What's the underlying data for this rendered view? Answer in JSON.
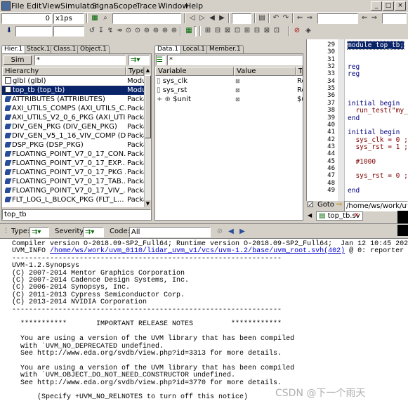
{
  "menu": {
    "items": [
      "File",
      "Edit",
      "View",
      "Simulator",
      "Signal",
      "Scope",
      "Trace",
      "Window",
      "Help"
    ]
  },
  "toolbar": {
    "time_value": "0",
    "time_unit": "x1ps"
  },
  "hierarchy_pane": {
    "tabs": [
      "Hier.1",
      "Stack.1",
      "Class.1",
      "Object.1"
    ],
    "sim_button": "Sim",
    "filter": "*",
    "columns": [
      "Hierarchy",
      "Type"
    ],
    "rows": [
      {
        "name": "glbl (glbl)",
        "type": "Modu",
        "kind": "box"
      },
      {
        "name": "top_tb (top_tb)",
        "type": "Modu",
        "kind": "box",
        "selected": true
      },
      {
        "name": "ATTRIBUTES (ATTRIBUTES)",
        "type": "Packa",
        "kind": "pkg"
      },
      {
        "name": "AXI_UTILS_COMPS (AXI_UTILS_C...",
        "type": "Packa",
        "kind": "pkg"
      },
      {
        "name": "AXI_UTILS_V2_0_6_PKG (AXI_UTIL...",
        "type": "Packa",
        "kind": "pkg"
      },
      {
        "name": "DIV_GEN_PKG (DIV_GEN_PKG)",
        "type": "Packa",
        "kind": "pkg"
      },
      {
        "name": "DIV_GEN_V5_1_16_VIV_COMP (D...",
        "type": "Packa",
        "kind": "pkg"
      },
      {
        "name": "DSP_PKG (DSP_PKG)",
        "type": "Packa",
        "kind": "pkg"
      },
      {
        "name": "FLOATING_POINT_V7_0_17_CON...",
        "type": "Packa",
        "kind": "pkg"
      },
      {
        "name": "FLOATING_POINT_V7_0_17_EXP...",
        "type": "Packa",
        "kind": "pkg"
      },
      {
        "name": "FLOATING_POINT_V7_0_17_PKG ...",
        "type": "Packa",
        "kind": "pkg"
      },
      {
        "name": "FLOATING_POINT_V7_0_17_TAB...",
        "type": "Packa",
        "kind": "pkg"
      },
      {
        "name": "FLOATING_POINT_V7_0_17_VIV_...",
        "type": "Packa",
        "kind": "pkg"
      },
      {
        "name": "FLT_LOG_L_BLOCK_PKG (FLT_L...",
        "type": "Packa",
        "kind": "pkg"
      }
    ],
    "scope_input": "top_tb"
  },
  "data_pane": {
    "tabs": [
      "Data.1",
      "Local.1",
      "Member.1"
    ],
    "filter": "*",
    "columns": [
      "Variable",
      "Value",
      "Ty"
    ],
    "rows": [
      {
        "name": "sys_clk",
        "type": "Re"
      },
      {
        "name": "sys_rst",
        "type": "Re"
      },
      {
        "name": "$unit",
        "type": "$u",
        "expandable": true
      }
    ]
  },
  "source_pane": {
    "lines": [
      {
        "n": "29",
        "code": "module top_tb;",
        "selected": true
      },
      {
        "n": "30",
        "code": ""
      },
      {
        "n": "31",
        "code": ""
      },
      {
        "n": "32",
        "code": "reg"
      },
      {
        "n": "33",
        "code": "reg"
      },
      {
        "n": "34",
        "code": ""
      },
      {
        "n": "35",
        "code": ""
      },
      {
        "n": "36",
        "code": ""
      },
      {
        "n": "37",
        "code": "initial begin"
      },
      {
        "n": "38",
        "code": "  run_test(\"my_"
      },
      {
        "n": "39",
        "code": "end"
      },
      {
        "n": "40",
        "code": ""
      },
      {
        "n": "41",
        "code": "initial begin"
      },
      {
        "n": "42",
        "code": "  sys_clk = 0 ;"
      },
      {
        "n": "43",
        "code": "  sys_rst = 1 ;"
      },
      {
        "n": "44",
        "code": ""
      },
      {
        "n": "45",
        "code": "  #1000"
      },
      {
        "n": "46",
        "code": ""
      },
      {
        "n": "47",
        "code": "  sys_rst = 0 ;"
      },
      {
        "n": "48",
        "code": ""
      },
      {
        "n": "49",
        "code": "end"
      }
    ],
    "goto_label": "Goto",
    "path": "/home/ws/work/uvm_0",
    "file_tab": "top_tb.sv"
  },
  "console_toolbar": {
    "type_label": "Type:",
    "severity_label": "Severity:",
    "code_label": "Code:",
    "code_value": "All"
  },
  "console": {
    "lines": [
      "Compiler version O-2018.09-SP2_Full64; Runtime version O-2018.09-SP2_Full64;  Jan 12 10:45 2022",
      "UVM_INFO ",
      "",
      "UVM-1.2.Synopsys",
      "(C) 2007-2014 Mentor Graphics Corporation",
      "(C) 2007-2014 Cadence Design Systems, Inc.",
      "(C) 2006-2014 Synopsys, Inc.",
      "(C) 2011-2013 Cypress Semiconductor Corp.",
      "(C) 2013-2014 NVIDIA Corporation",
      "",
      "",
      "  ***********       IMPORTANT RELEASE NOTES         ************",
      "",
      "  You are using a version of the UVM library that has been compiled",
      "  with `UVM_NO_DEPRECATED undefined.",
      "  See http://www.eda.org/svdb/view.php?id=3313 for more details.",
      "",
      "  You are using a version of the UVM library that has been compiled",
      "  with `UVM_OBJECT_DO_NOT_NEED_CONSTRUCTOR undefined.",
      "  See http://www.eda.org/svdb/view.php?id=3770 for more details.",
      "",
      "      (Specify +UVM_NO_RELNOTES to turn off this notice)"
    ],
    "uvm_info_link": "/home/ws/work/uvm_0110/lidar_uvm_v1/vcs/uvm-1.2/base/uvm_root.svh(402)",
    "uvm_info_tail": " @ 0: reporter [U",
    "separator": "----------------------------------------------------------------"
  },
  "watermark": "CSDN @下一个雨天"
}
